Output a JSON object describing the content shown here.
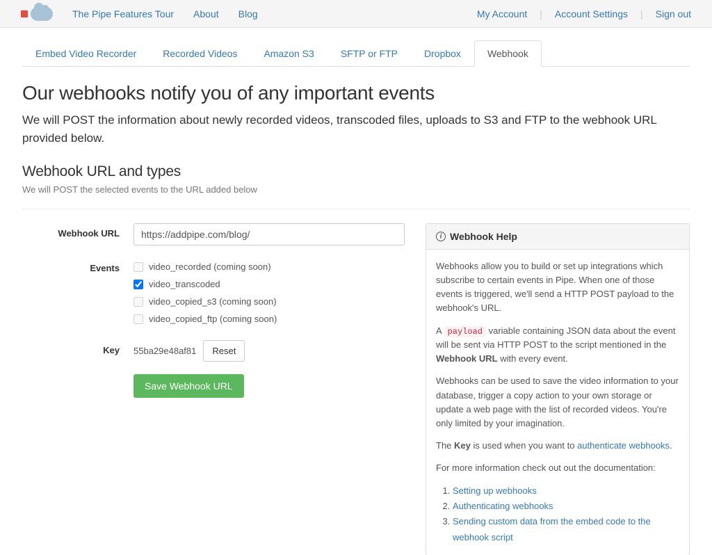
{
  "topbar": {
    "left": [
      "The Pipe Features Tour",
      "About",
      "Blog"
    ],
    "right": [
      "My Account",
      "Account Settings",
      "Sign out"
    ]
  },
  "tabs": [
    "Embed Video Recorder",
    "Recorded Videos",
    "Amazon S3",
    "SFTP or FTP",
    "Dropbox",
    "Webhook"
  ],
  "active_tab": "Webhook",
  "page": {
    "title": "Our webhooks notify you of any important events",
    "lead": "We will POST the information about newly recorded videos, transcoded files, uploads to S3 and FTP to the webhook URL provided below.",
    "section_title": "Webhook URL and types",
    "section_sub": "We will POST the selected events to the URL added below"
  },
  "form": {
    "labels": {
      "url": "Webhook URL",
      "events": "Events",
      "key": "Key"
    },
    "url_value": "https://addpipe.com/blog/",
    "events": [
      {
        "label": "video_recorded (coming soon)",
        "checked": false,
        "disabled": true
      },
      {
        "label": "video_transcoded",
        "checked": true,
        "disabled": false
      },
      {
        "label": "video_copied_s3 (coming soon)",
        "checked": false,
        "disabled": true
      },
      {
        "label": "video_copied_ftp (coming soon)",
        "checked": false,
        "disabled": true
      }
    ],
    "key_value": "55ba29e48af81",
    "reset_label": "Reset",
    "save_label": "Save Webhook URL"
  },
  "help": {
    "title": "Webhook Help",
    "p1": "Webhooks allow you to build or set up integrations which subscribe to certain events in Pipe. When one of those events is triggered, we'll send a HTTP POST payload to the webhook's URL.",
    "p2a": "A ",
    "p2_code": "payload",
    "p2b": " variable containing JSON data about the event will be sent via HTTP POST to the script mentioned in the ",
    "p2_strong": "Webhook URL",
    "p2c": " with every event.",
    "p3": "Webhooks can be used to save the video information to your database, trigger a copy action to your own storage or update a web page with the list of recorded videos. You're only limited by your imagination.",
    "p4a": "The ",
    "p4_strong": "Key",
    "p4b": " is used when you want to ",
    "p4_link": "authenticate webhooks",
    "p4c": ".",
    "p5": "For more information check out out the documentation:",
    "links": [
      "Setting up webhooks",
      "Authenticating webhooks",
      "Sending custom data from the embed code to the webhook script"
    ]
  }
}
